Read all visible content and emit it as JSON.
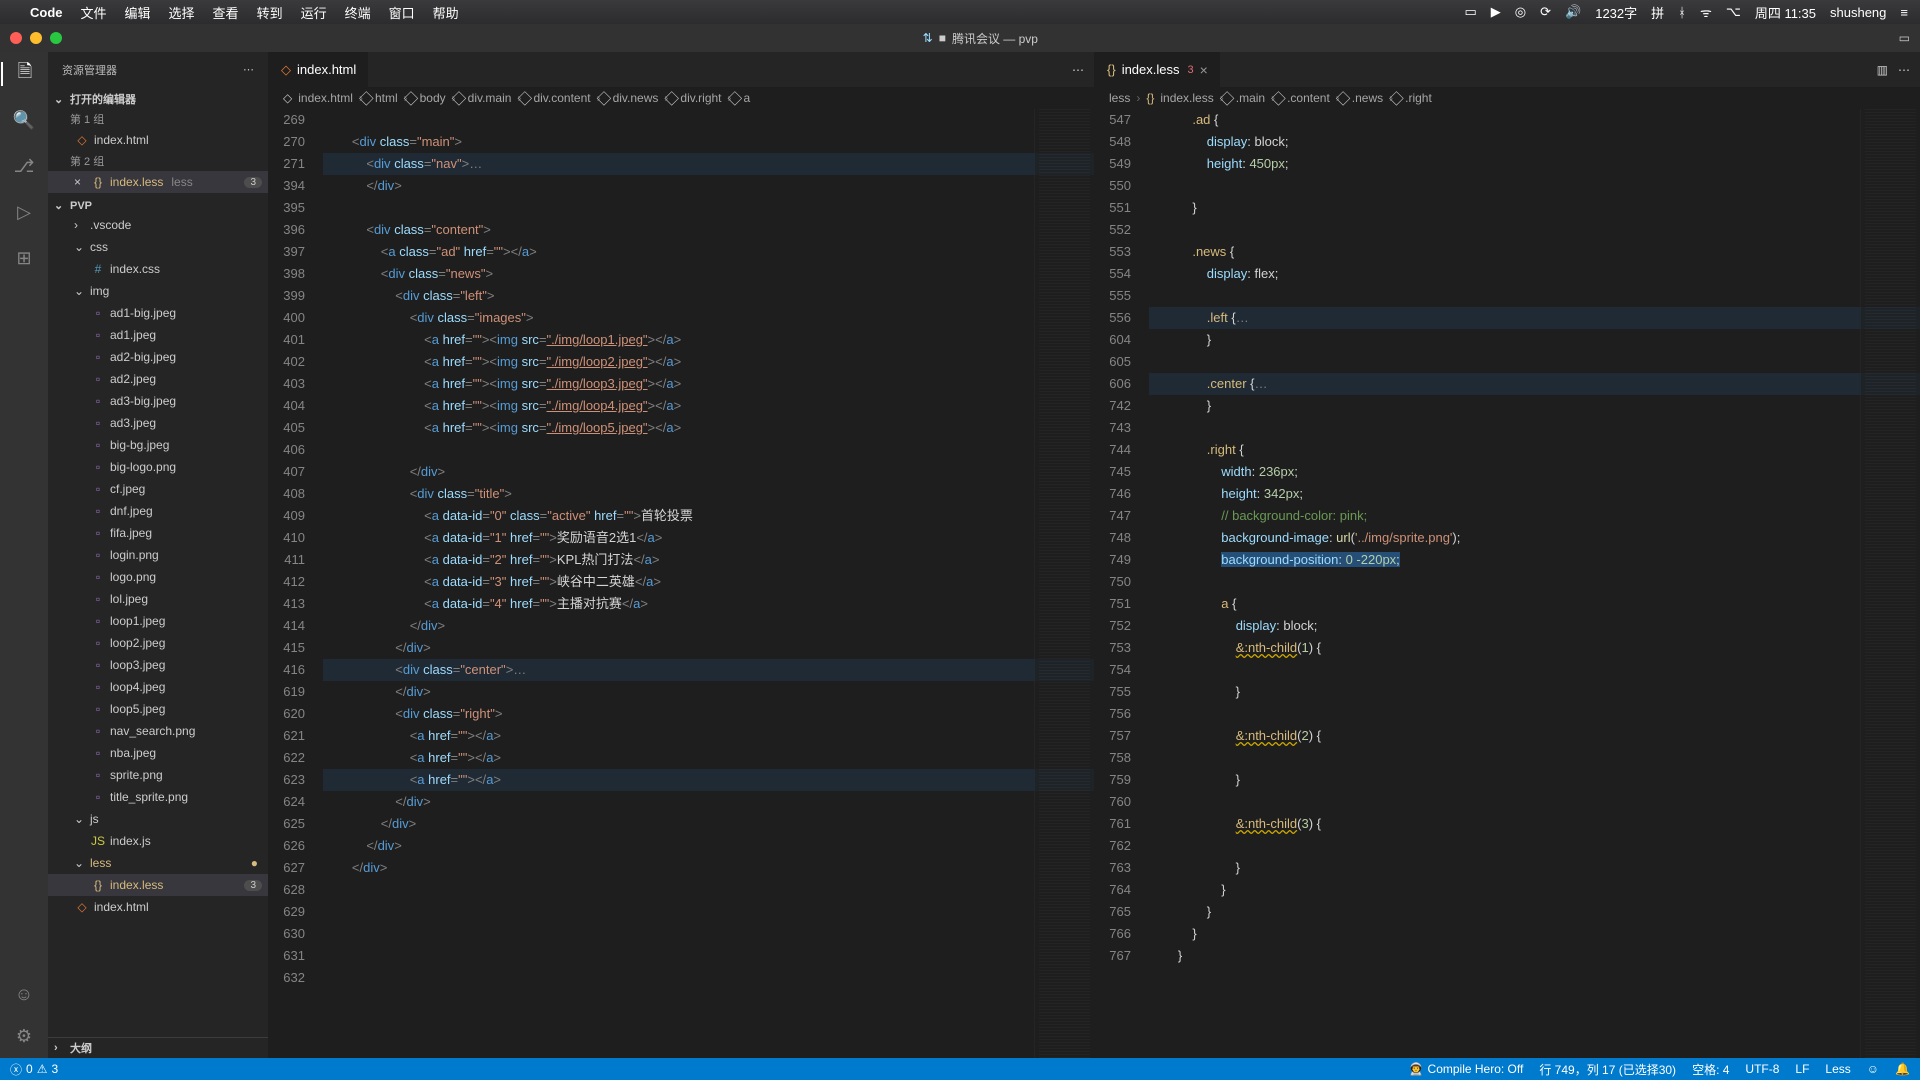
{
  "mac": {
    "app": "Code",
    "menus": [
      "文件",
      "编辑",
      "选择",
      "查看",
      "转到",
      "运行",
      "终端",
      "窗口",
      "帮助"
    ],
    "ime": "1232字",
    "clock": "周四 11:35",
    "user": "shusheng"
  },
  "titlebar": {
    "meeting": "腾讯会议 — pvp"
  },
  "sidebar": {
    "title": "资源管理器",
    "openEditors": "打开的编辑器",
    "group1": "第 1 组",
    "group2": "第 2 组",
    "openFiles": {
      "f1": "index.html",
      "f2": "index.less",
      "f2tag": "less",
      "f2num": "3"
    },
    "project": "PVP",
    "folders": {
      "vscode": ".vscode",
      "css": "css",
      "img": "img",
      "js": "js",
      "less": "less"
    },
    "files": {
      "indexcss": "index.css",
      "ad1b": "ad1-big.jpeg",
      "ad1": "ad1.jpeg",
      "ad2b": "ad2-big.jpeg",
      "ad2": "ad2.jpeg",
      "ad3b": "ad3-big.jpeg",
      "ad3": "ad3.jpeg",
      "bigbg": "big-bg.jpeg",
      "biglogo": "big-logo.png",
      "cf": "cf.jpeg",
      "dnf": "dnf.jpeg",
      "fifa": "fifa.jpeg",
      "login": "login.png",
      "logo": "logo.png",
      "lol": "lol.jpeg",
      "l1": "loop1.jpeg",
      "l2": "loop2.jpeg",
      "l3": "loop3.jpeg",
      "l4": "loop4.jpeg",
      "l5": "loop5.jpeg",
      "nav": "nav_search.png",
      "nba": "nba.jpeg",
      "sprite": "sprite.png",
      "ts": "title_sprite.png",
      "indexjs": "index.js",
      "indexless": "index.less",
      "indexless_num": "3",
      "indexhtml": "index.html"
    },
    "outline": "大纲"
  },
  "pane1": {
    "tab": "index.html",
    "crumbs": [
      "index.html",
      "html",
      "body",
      "div.main",
      "div.content",
      "div.news",
      "div.right",
      "a"
    ],
    "lines": [
      "269",
      "270",
      "271",
      "394",
      "395",
      "396",
      "397",
      "398",
      "399",
      "400",
      "401",
      "402",
      "403",
      "404",
      "405",
      "406",
      "407",
      "408",
      "409",
      "410",
      "411",
      "412",
      "413",
      "414",
      "415",
      "416",
      "619",
      "620",
      "621",
      "622",
      "623",
      "624",
      "625",
      "626",
      "627",
      "628",
      "629",
      "630",
      "631",
      "632"
    ],
    "text": {
      "main_open": "        <div class=\"main\">",
      "nav_open": "            <div class=\"nav\">",
      "nav_fold": "…",
      "div_close12": "            </div>",
      "blank": "",
      "content_open": "            <div class=\"content\">",
      "ad": "                <a class=\"ad\" href=\"\"></a>",
      "news_open": "                <div class=\"news\">",
      "left_open": "                    <div class=\"left\">",
      "images_open": "                        <div class=\"images\">",
      "img1": "                            <a href=\"\"><img src=\"./img/loop1.jpeg\"></a>",
      "img2": "                            <a href=\"\"><img src=\"./img/loop2.jpeg\"></a>",
      "img3": "                            <a href=\"\"><img src=\"./img/loop3.jpeg\"></a>",
      "img4": "                            <a href=\"\"><img src=\"./img/loop4.jpeg\"></a>",
      "img5": "                            <a href=\"\"><img src=\"./img/loop5.jpeg\"></a>",
      "images_close": "                        </div>",
      "title_open": "                        <div class=\"title\">",
      "a0": "                            <a data-id=\"0\" class=\"active\" href=\"\">首轮投票",
      "a1": "                            <a data-id=\"1\" href=\"\">奖励语音2选1</a>",
      "a2": "                            <a data-id=\"2\" href=\"\">KPL热门打法</a>",
      "a3": "                            <a data-id=\"3\" href=\"\">峡谷中二英雄</a>",
      "a4": "                            <a data-id=\"4\" href=\"\">主播对抗赛</a>",
      "title_close": "                        </div>",
      "left_close": "                    </div>",
      "center_open": "                    <div class=\"center\">",
      "center_fold": "…",
      "center_close": "                    </div>",
      "right_open": "                    <div class=\"right\">",
      "ra1": "                        <a href=\"\"></a>",
      "ra2": "                        <a href=\"\"></a>",
      "ra3": "                        <a href=\"\"></a>",
      "right_close": "                    </div>",
      "news_close": "                </div>",
      "content_close": "            </div>",
      "main_close": "        </div>"
    }
  },
  "pane2": {
    "tab": "index.less",
    "tabErr": "3",
    "crumbs": [
      "less",
      "index.less",
      ".main",
      ".content",
      ".news",
      ".right"
    ],
    "lines": [
      "547",
      "548",
      "549",
      "550",
      "551",
      "552",
      "553",
      "554",
      "555",
      "556",
      "604",
      "605",
      "606",
      "742",
      "743",
      "744",
      "745",
      "746",
      "747",
      "748",
      "749",
      "750",
      "751",
      "752",
      "753",
      "754",
      "755",
      "756",
      "757",
      "758",
      "759",
      "760",
      "761",
      "762",
      "763",
      "764",
      "765",
      "766",
      "767"
    ]
  },
  "status": {
    "errors": "0",
    "warnings": "3",
    "compile": "Compile Hero: Off",
    "pos": "行 749，列 17 (已选择30)",
    "spaces": "空格: 4",
    "enc": "UTF-8",
    "eol": "LF",
    "lang": "Less"
  }
}
